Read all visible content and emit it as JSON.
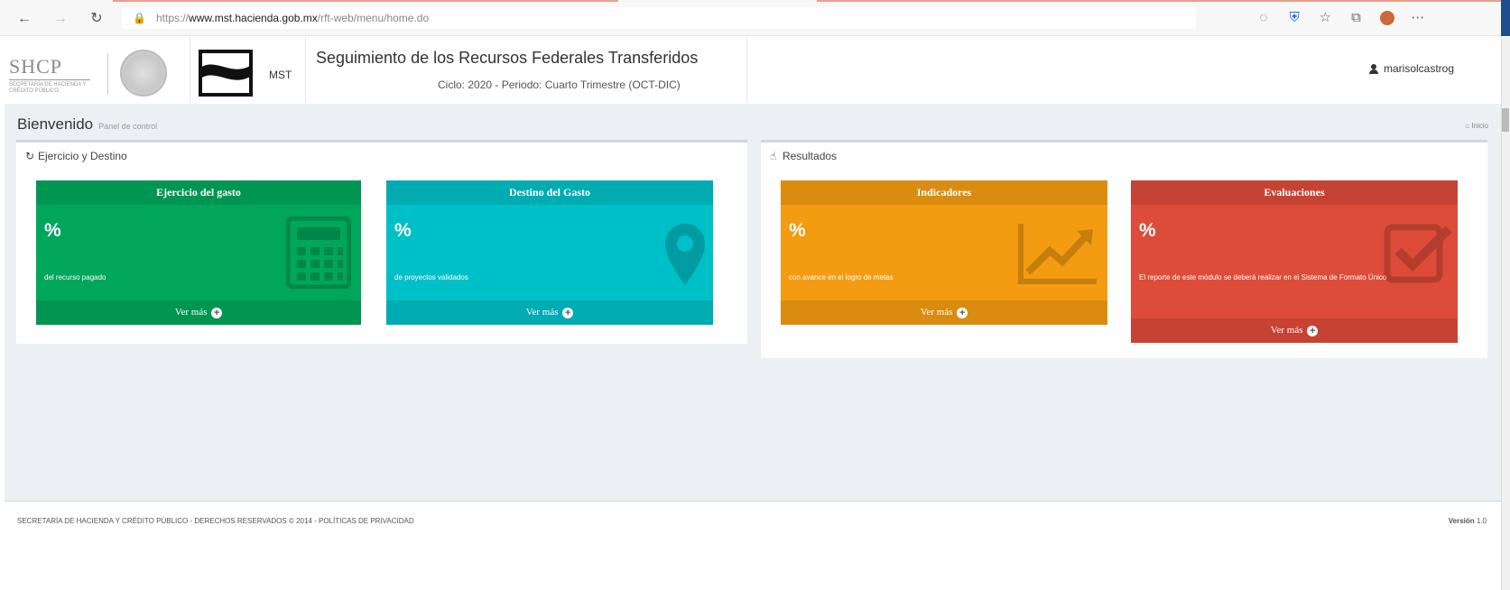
{
  "browser": {
    "url_prefix": "https://",
    "url_host": "www.mst.hacienda.gob.mx",
    "url_path": "/rft-web/menu/home.do"
  },
  "header": {
    "logo_text": "SHCP",
    "logo_sub": "SECRETARÍA DE HACIENDA Y CRÉDITO PÚBLICO",
    "mst_label": "MST",
    "title": "Seguimiento de los Recursos Federales Transferidos",
    "subtitle": "Ciclo: 2020 - Periodo: Cuarto Trimestre (OCT-DIC)",
    "user": "marisolcastrog"
  },
  "page": {
    "title": "Bienvenido",
    "subtitle": "Panel de control",
    "home_link": "Inicio"
  },
  "boxes": {
    "left_title": "Ejercicio y Destino",
    "right_title": "Resultados"
  },
  "tiles": {
    "ejercicio": {
      "title": "Ejercicio del gasto",
      "value": "%",
      "desc": "del recurso pagado",
      "link": "Ver más",
      "icon": "calculator-icon",
      "color": "#00a65a"
    },
    "destino": {
      "title": "Destino del Gasto",
      "value": "%",
      "desc": "de proyectos validados",
      "link": "Ver más",
      "icon": "map-marker-icon",
      "color": "#00c0c7"
    },
    "indicadores": {
      "title": "Indicadores",
      "value": "%",
      "desc": "con avance en el logro de metas",
      "link": "Ver más",
      "icon": "line-chart-icon",
      "color": "#f39c12"
    },
    "evaluaciones": {
      "title": "Evaluaciones",
      "value": "%",
      "desc": "El reporte de este módulo se deberá realizar en el Sistema de Formato Único",
      "link": "Ver más",
      "icon": "check-square-icon",
      "color": "#dd4b39"
    }
  },
  "footer": {
    "left": "SECRETARÍA DE HACIENDA Y CRÉDITO PÚBLICO - DERECHOS RESERVADOS © 2014 - POLÍTICAS DE PRIVACIDAD",
    "version_label": "Versión",
    "version_value": "1.0"
  }
}
